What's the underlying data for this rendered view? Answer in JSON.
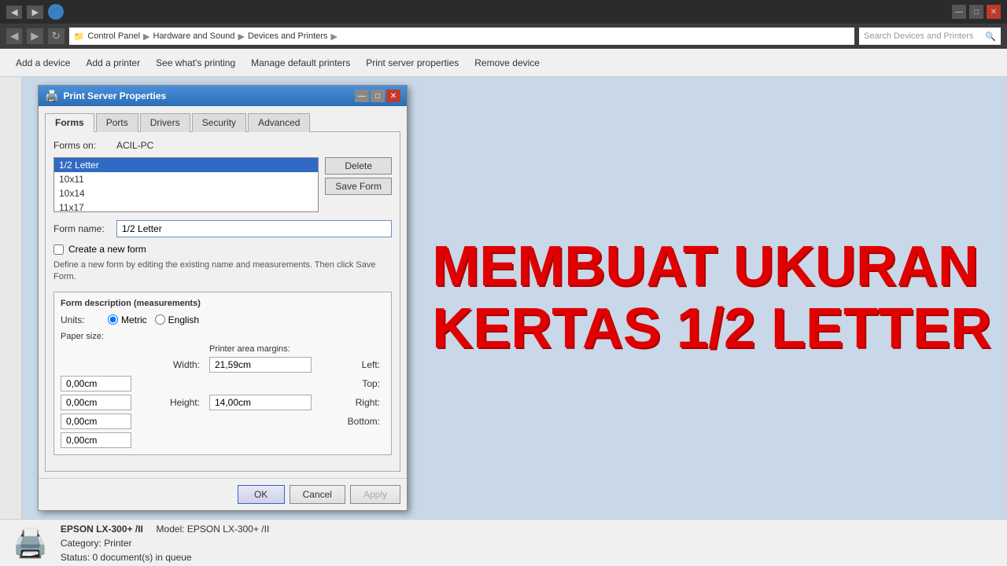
{
  "browser": {
    "controls": {
      "minimize": "—",
      "maximize": "□",
      "close": "✕"
    },
    "breadcrumb": {
      "items": [
        "Control Panel",
        "Hardware and Sound",
        "Devices and Printers"
      ],
      "sep": "▶"
    },
    "search_placeholder": "Search Devices and Printers"
  },
  "toolbar": {
    "buttons": [
      "Add a device",
      "Add a printer",
      "See what's printing",
      "Manage default printers",
      "Print server properties",
      "Remove device"
    ]
  },
  "dialog": {
    "title": "Print Server Properties",
    "tabs": [
      "Forms",
      "Ports",
      "Drivers",
      "Security",
      "Advanced"
    ],
    "active_tab": "Forms",
    "forms_on_label": "Forms on:",
    "forms_on_value": "ACIL-PC",
    "list_items": [
      "1/2 Letter",
      "10x11",
      "10x14",
      "11x17"
    ],
    "selected_item": "1/2 Letter",
    "buttons": {
      "delete": "Delete",
      "save_form": "Save Form"
    },
    "form_name_label": "Form name:",
    "form_name_value": "1/2 Letter",
    "create_new_label": "Create a new form",
    "description_text": "Define a new form by editing the existing name and measurements. Then click Save Form.",
    "form_desc_title": "Form description (measurements)",
    "units_label": "Units:",
    "metric_label": "Metric",
    "english_label": "English",
    "paper_size_label": "Paper size:",
    "printer_area_label": "Printer area margins:",
    "width_label": "Width:",
    "width_value": "21,59cm",
    "height_label": "Height:",
    "height_value": "14,00cm",
    "left_label": "Left:",
    "left_value": "0,00cm",
    "right_label": "Right:",
    "right_value": "0,00cm",
    "top_label": "Top:",
    "top_value": "0,00cm",
    "bottom_label": "Bottom:",
    "bottom_value": "0,00cm",
    "ok_label": "OK",
    "cancel_label": "Cancel",
    "apply_label": "Apply"
  },
  "overlay_text": {
    "line1": "MEMBUAT UKURAN",
    "line2": "KERTAS 1/2 LETTER"
  },
  "statusbar": {
    "printer_name": "EPSON LX-300+ /II",
    "model_label": "Model:",
    "model_value": "EPSON LX-300+ /II",
    "category_label": "Category:",
    "category_value": "Printer",
    "status_label": "Status:",
    "status_value": "0 document(s) in queue"
  }
}
